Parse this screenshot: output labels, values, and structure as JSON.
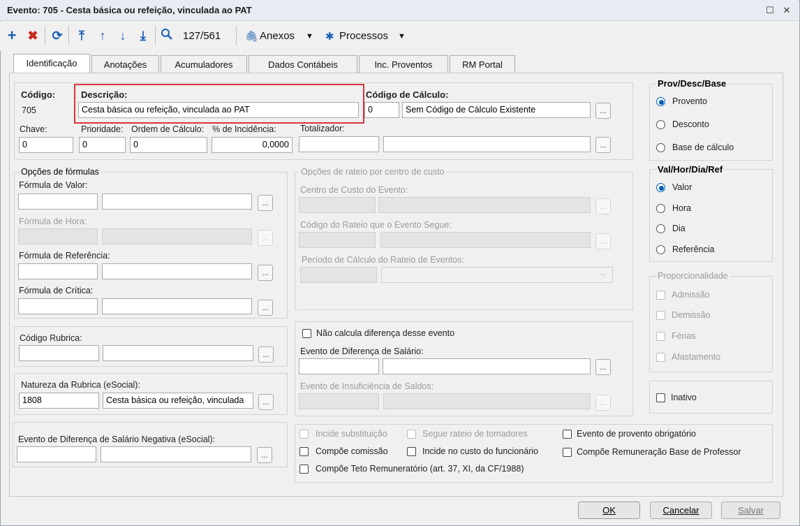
{
  "window": {
    "title": "Evento: 705 - Cesta básica ou refeição, vinculada ao PAT"
  },
  "toolbar": {
    "record_counter": "127/561",
    "anexos_label": "Anexos",
    "processos_label": "Processos"
  },
  "tabs": [
    {
      "label": "Identificação"
    },
    {
      "label": "Anotações"
    },
    {
      "label": "Acumuladores"
    },
    {
      "label": "Dados Contábeis"
    },
    {
      "label": "Inc. Proventos"
    },
    {
      "label": "RM Portal"
    }
  ],
  "ident": {
    "codigo_label": "Código:",
    "codigo_value": "705",
    "descricao_label": "Descrição:",
    "descricao_value": "Cesta básica ou refeição, vinculada ao PAT",
    "codcalc_label": "Código de Cálculo:",
    "codcalc_code": "0",
    "codcalc_desc": "Sem Código de Cálculo Existente",
    "chave_label": "Chave:",
    "chave_value": "0",
    "prioridade_label": "Prioridade:",
    "prioridade_value": "0",
    "ordem_label": "Ordem de Cálculo:",
    "ordem_value": "0",
    "incidencia_label": "% de Incidência:",
    "incidencia_value": "0,0000",
    "totalizador_label": "Totalizador:"
  },
  "formulas": {
    "title": "Opções de fórmulas",
    "valor_label": "Fórmula de Valor:",
    "hora_label": "Fórmula de Hora:",
    "referencia_label": "Fórmula de Referência:",
    "critica_label": "Fórmula de Crítica:"
  },
  "rateio": {
    "title": "Opções de rateio por centro de custo",
    "centro_label": "Centro de Custo do Evento:",
    "codigo_label": "Código do Rateio que o Evento Segue:",
    "periodo_label": "Período de Cálculo do Rateio de Eventos:"
  },
  "rubrica": {
    "codigo_label": "Código Rubrica:"
  },
  "natureza": {
    "label": "Natureza da Rubrica (eSocial):",
    "code": "1808",
    "desc": "Cesta básica ou refeição, vinculada"
  },
  "dif_negativa": {
    "label": "Evento de Diferença de Salário Negativa (eSocial):"
  },
  "diferenca": {
    "nao_calcula_label": "Não calcula diferença desse evento",
    "evento_dif_label": "Evento de Diferença de Salário:",
    "evento_insuf_label": "Evento de Insuficiência de Saldos:"
  },
  "checks": {
    "incide_subst": "Incide substituição",
    "segue_rateio": "Segue rateio de tomadores",
    "provento_obrig": "Evento de provento obrigatório",
    "compoe_comissao": "Compõe comissão",
    "incide_custo": "Incide no custo do funcionário",
    "compoe_remun": "Compõe Remuneração Base de Professor",
    "compoe_teto": "Compõe Teto Remuneratório (art. 37, XI, da CF/1988)"
  },
  "prov": {
    "title": "Prov/Desc/Base",
    "opt1": "Provento",
    "opt2": "Desconto",
    "opt3": "Base de cálculo",
    "selected": "Provento"
  },
  "valhor": {
    "title": "Val/Hor/Dia/Ref",
    "opt1": "Valor",
    "opt2": "Hora",
    "opt3": "Dia",
    "opt4": "Referência",
    "selected": "Valor"
  },
  "proporc": {
    "title": "Proporcionalidade",
    "opt1": "Admissão",
    "opt2": "Demissão",
    "opt3": "Férias",
    "opt4": "Afastamento"
  },
  "inativo": {
    "label": "Inativo"
  },
  "buttons": {
    "ok": "OK",
    "cancelar": "Cancelar",
    "salvar": "Salvar"
  },
  "colors": {
    "accent": "#005fb8",
    "highlight": "#d9363e",
    "add": "#1a5fb4",
    "delete": "#c42b1c"
  }
}
